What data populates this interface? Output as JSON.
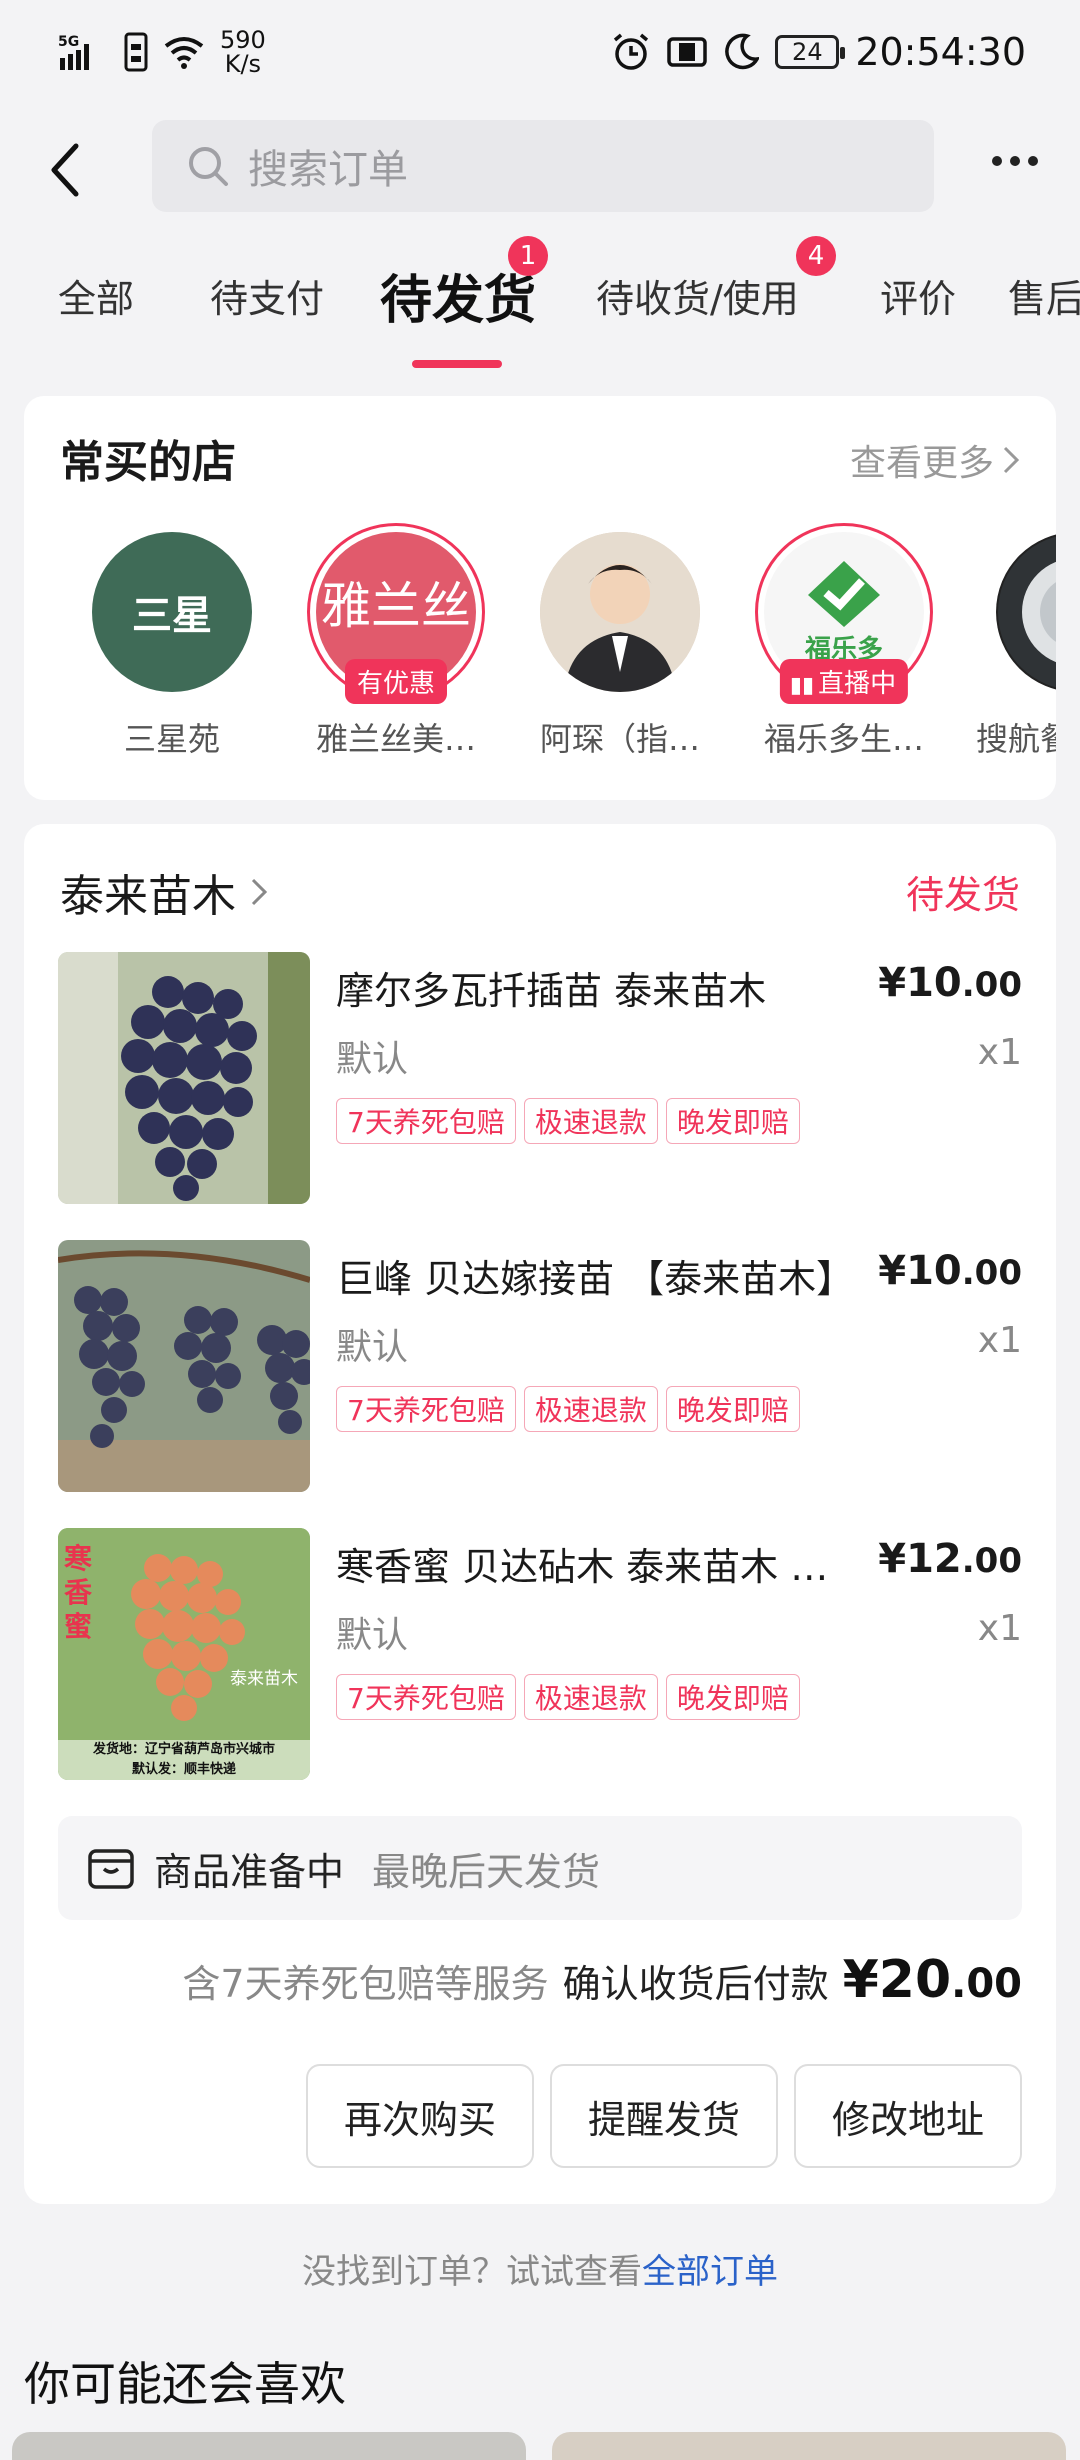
{
  "status_bar": {
    "network": "5G",
    "net_speed_value": "590",
    "net_speed_unit": "K/s",
    "battery": "24",
    "time": "20:54:30"
  },
  "header": {
    "back_icon": "back-arrow-icon",
    "search_placeholder": "搜索订单",
    "more_icon": "more-dots-icon"
  },
  "tabs": [
    {
      "label": "全部",
      "badge": ""
    },
    {
      "label": "待支付",
      "badge": ""
    },
    {
      "label": "待发货",
      "badge": "1",
      "active": true
    },
    {
      "label": "待收货/使用",
      "badge": "4"
    },
    {
      "label": "评价",
      "badge": ""
    },
    {
      "label": "售后",
      "badge": ""
    }
  ],
  "frequent_stores": {
    "title": "常买的店",
    "see_more": "查看更多",
    "stores": [
      {
        "name": "三星苑",
        "avatar_text": "三星",
        "tag": ""
      },
      {
        "name": "雅兰丝美…",
        "avatar_text": "雅兰丝",
        "tag": "有优惠"
      },
      {
        "name": "阿琛（指…",
        "avatar_text": "",
        "tag": ""
      },
      {
        "name": "福乐多生…",
        "avatar_text": "福乐多",
        "tag": "直播中"
      },
      {
        "name": "搜航餐",
        "avatar_text": "",
        "tag": ""
      }
    ]
  },
  "order": {
    "shop_name": "泰来苗木",
    "status": "待发货",
    "items": [
      {
        "title": "摩尔多瓦扦插苗   泰来苗木",
        "price_int": "¥10",
        "price_dec": ".00",
        "spec": "默认",
        "qty": "x1",
        "tags": [
          "7天养死包赔",
          "极速退款",
          "晚发即赔"
        ]
      },
      {
        "title": "巨峰 贝达嫁接苗 【泰来苗木】",
        "price_int": "¥10",
        "price_dec": ".00",
        "spec": "默认",
        "qty": "x1",
        "tags": [
          "7天养死包赔",
          "极速退款",
          "晚发即赔"
        ]
      },
      {
        "title": "寒香蜜 贝达砧木 泰来苗木 嫁接苗",
        "price_int": "¥12",
        "price_dec": ".00",
        "spec": "默认",
        "qty": "x1",
        "tags": [
          "7天养死包赔",
          "极速退款",
          "晚发即赔"
        ]
      }
    ],
    "item3_overlay": {
      "vertical": "寒香蜜",
      "brand": "泰来苗木",
      "ship_from": "发货地：辽宁省葫芦岛市兴城市",
      "courier": "默认发：顺丰快递"
    },
    "preparing_title": "商品准备中",
    "preparing_desc": "最晚后天发货",
    "total_note": "含7天养死包赔等服务",
    "total_label": "确认收货后付款",
    "total_int": "¥20",
    "total_dec": ".00",
    "buttons": [
      "再次购买",
      "提醒发货",
      "修改地址"
    ]
  },
  "hint": {
    "text": "没找到订单？试试查看",
    "link": "全部订单"
  },
  "recommend_title": "你可能还会喜欢",
  "colors": {
    "accent": "#f0345a",
    "link": "#2a62c9"
  }
}
